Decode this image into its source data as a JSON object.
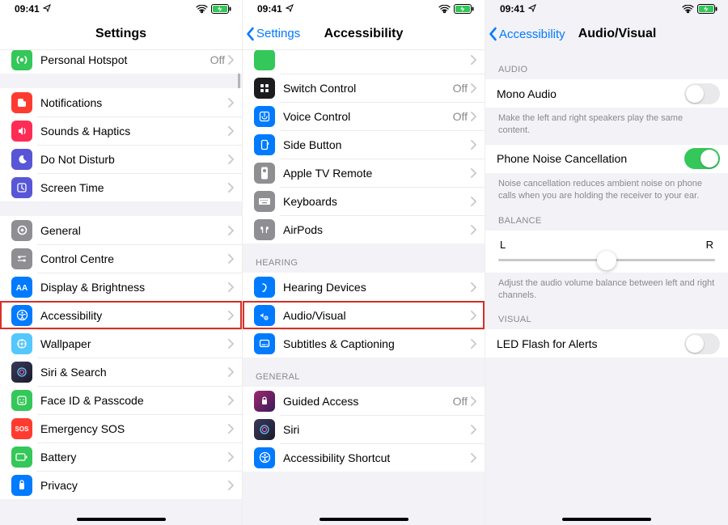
{
  "status": {
    "time": "09:41"
  },
  "phone1": {
    "title": "Settings",
    "topRow": {
      "label": "Personal Hotspot",
      "detail": "Off"
    },
    "g1": [
      {
        "label": "Notifications"
      },
      {
        "label": "Sounds & Haptics"
      },
      {
        "label": "Do Not Disturb"
      },
      {
        "label": "Screen Time"
      }
    ],
    "g2": [
      {
        "label": "General"
      },
      {
        "label": "Control Centre"
      },
      {
        "label": "Display & Brightness"
      },
      {
        "label": "Accessibility",
        "hl": true
      },
      {
        "label": "Wallpaper"
      },
      {
        "label": "Siri & Search"
      },
      {
        "label": "Face ID & Passcode"
      },
      {
        "label": "Emergency SOS"
      },
      {
        "label": "Battery"
      },
      {
        "label": "Privacy"
      }
    ]
  },
  "phone2": {
    "back": "Settings",
    "title": "Accessibility",
    "g1": [
      {
        "label": "Switch Control",
        "detail": "Off"
      },
      {
        "label": "Voice Control",
        "detail": "Off"
      },
      {
        "label": "Side Button"
      },
      {
        "label": "Apple TV Remote"
      },
      {
        "label": "Keyboards"
      },
      {
        "label": "AirPods"
      }
    ],
    "hHearing": "HEARING",
    "g2": [
      {
        "label": "Hearing Devices"
      },
      {
        "label": "Audio/Visual",
        "hl": true
      },
      {
        "label": "Subtitles & Captioning"
      }
    ],
    "hGeneral": "GENERAL",
    "g3": [
      {
        "label": "Guided Access",
        "detail": "Off"
      },
      {
        "label": "Siri"
      },
      {
        "label": "Accessibility Shortcut"
      }
    ]
  },
  "phone3": {
    "back": "Accessibility",
    "title": "Audio/Visual",
    "hAudio": "AUDIO",
    "mono": {
      "label": "Mono Audio",
      "on": false
    },
    "monoFoot": "Make the left and right speakers play the same content.",
    "noise": {
      "label": "Phone Noise Cancellation",
      "on": true
    },
    "noiseFoot": "Noise cancellation reduces ambient noise on phone calls when you are holding the receiver to your ear.",
    "hBalance": "BALANCE",
    "balL": "L",
    "balR": "R",
    "balFoot": "Adjust the audio volume balance between left and right channels.",
    "hVisual": "VISUAL",
    "led": {
      "label": "LED Flash for Alerts",
      "on": false
    }
  }
}
